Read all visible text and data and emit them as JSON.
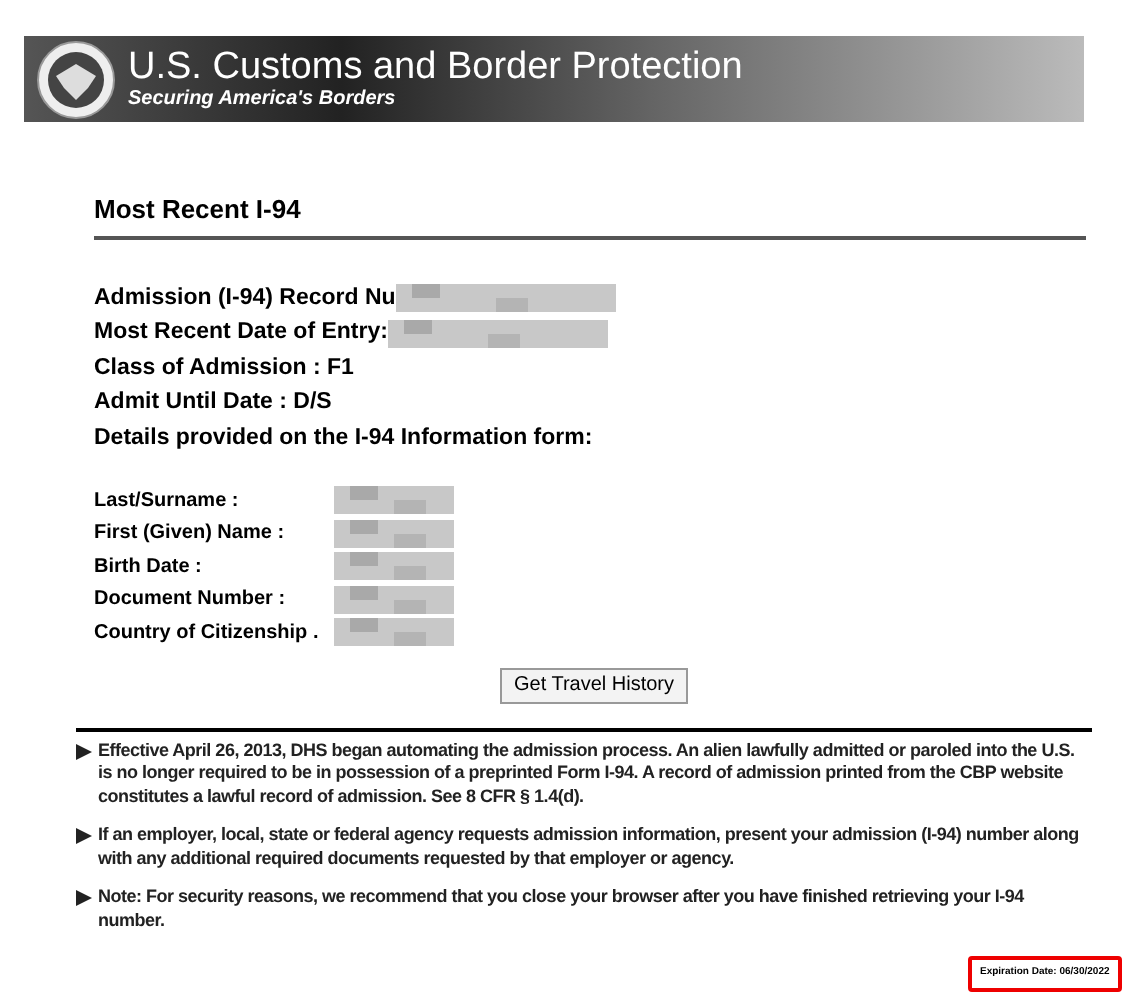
{
  "banner": {
    "title": "U.S. Customs and Border Protection",
    "subtitle": "Securing America's Borders"
  },
  "heading": "Most Recent I-94",
  "record": [
    {
      "label": "Admission (I-94) Record Nu",
      "redacted": true
    },
    {
      "label": "Most Recent Date of Entry:",
      "redacted": true
    },
    {
      "label": "Class of Admission : F1",
      "redacted": false
    },
    {
      "label": "Admit Until Date : D/S",
      "redacted": false
    },
    {
      "label": "Details provided on the I-94 Information form:",
      "redacted": false
    }
  ],
  "details": [
    {
      "label": "Last/Surname :",
      "redacted": true
    },
    {
      "label": "First (Given) Name :",
      "redacted": true
    },
    {
      "label": "Birth Date :",
      "redacted": true
    },
    {
      "label": "Document Number :",
      "redacted": true
    },
    {
      "label": "Country of Citizenship .",
      "redacted": true
    }
  ],
  "button": "Get Travel History",
  "notes": [
    "Effective April 26, 2013, DHS began automating the admission process. An alien lawfully admitted or paroled into the U.S. is no longer required to be in possession of a preprinted Form I-94. A record of admission printed from the CBP website constitutes a lawful record of admission. See 8 CFR § 1.4(d).",
    "If an employer, local, state or federal agency requests admission information, present your admission (I-94) number along with any additional required documents requested by that employer or agency.",
    "Note: For security reasons, we recommend that you close your browser after you have finished retrieving your I-94 number."
  ],
  "expiration": "Expiration Date: 06/30/2022"
}
